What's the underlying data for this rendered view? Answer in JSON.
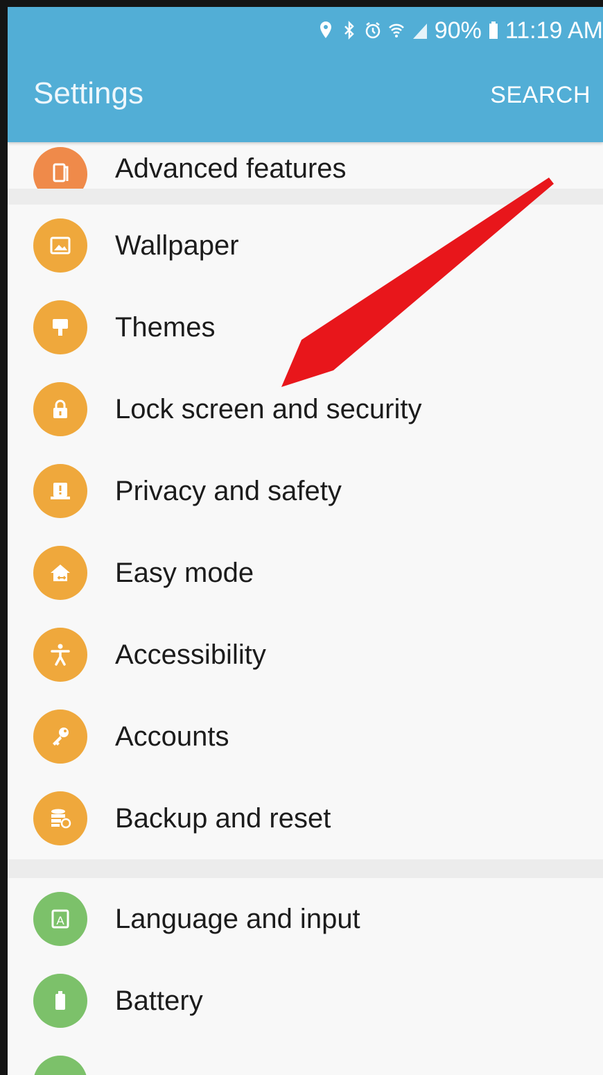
{
  "status_bar": {
    "battery_text": "90%",
    "time": "11:19 AM",
    "icons": [
      "location-icon",
      "bluetooth-icon",
      "alarm-icon",
      "wifi-icon",
      "signal-icon",
      "battery-icon"
    ]
  },
  "header": {
    "title": "Settings",
    "search_label": "SEARCH",
    "background": "#52aed6"
  },
  "colors": {
    "orange": "#efa83c",
    "deep_orange": "#ef8a4a",
    "green": "#7cc16a",
    "annotation_arrow": "#e8161b"
  },
  "settings": {
    "items": [
      {
        "label": "Advanced features",
        "icon": "advanced-features-icon"
      },
      {
        "label": "Wallpaper",
        "icon": "wallpaper-icon"
      },
      {
        "label": "Themes",
        "icon": "themes-icon"
      },
      {
        "label": "Lock screen and security",
        "icon": "lock-icon"
      },
      {
        "label": "Privacy and safety",
        "icon": "privacy-icon"
      },
      {
        "label": "Easy mode",
        "icon": "easy-mode-icon"
      },
      {
        "label": "Accessibility",
        "icon": "accessibility-icon"
      },
      {
        "label": "Accounts",
        "icon": "key-icon"
      },
      {
        "label": "Backup and reset",
        "icon": "backup-icon"
      },
      {
        "label": "Language and input",
        "icon": "language-icon"
      },
      {
        "label": "Battery",
        "icon": "battery-settings-icon"
      }
    ]
  }
}
